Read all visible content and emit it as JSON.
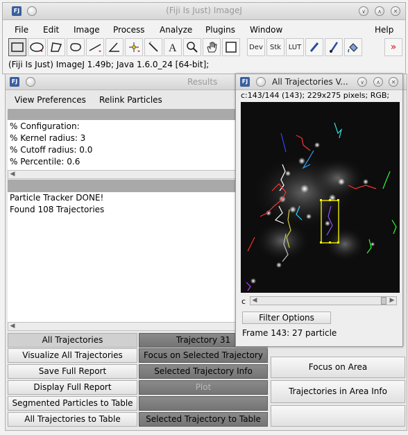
{
  "main_window": {
    "title": "(Fiji Is Just) ImageJ",
    "menu": [
      "File",
      "Edit",
      "Image",
      "Process",
      "Analyze",
      "Plugins",
      "Window",
      "Help"
    ],
    "tools": {
      "dev_label": "Dev",
      "stk_label": "Stk",
      "lut_label": "LUT",
      "more_label": "»"
    },
    "status": "(Fiji Is Just) ImageJ 1.49b; Java 1.6.0_24 [64-bit];"
  },
  "results_window": {
    "title": "Results",
    "menu": [
      "View Preferences",
      "Relink Particles"
    ],
    "config_lines": [
      "% Configuration:",
      "% Kernel radius: 3",
      "% Cutoff radius: 0.0",
      "% Percentile: 0.6"
    ],
    "log_lines": [
      "Particle Tracker DONE!",
      "Found 108 Trajectories"
    ],
    "buttons": {
      "all_trajectories_header": "All Trajectories",
      "trajectory_header": "Trajectory 31",
      "visualize_all": "Visualize All Trajectories",
      "focus_selected": "Focus on Selected Trajectory",
      "save_full_report": "Save Full Report",
      "selected_info": "Selected Trajectory Info",
      "display_full_report": "Display Full Report",
      "plot": "Plot",
      "segmented_to_table": "Segmented Particles to Table",
      "empty_right": "",
      "all_to_table": "All Trajectories to Table",
      "selected_to_table": "Selected Trajectory to Table",
      "focus_on_area": "Focus on Area",
      "area_info": "Trajectories in Area Info"
    }
  },
  "traj_window": {
    "title": "All Trajectories V...",
    "info": "c:143/144 (143); 229x275 pixels; RGB;",
    "slider_label": "c",
    "filter_button": "Filter Options",
    "frame_status": "Frame 143: 27 particle"
  },
  "colors": {
    "dark_button": "#808080",
    "title_text": "#9a9a9a",
    "image_bg": "#0d0d0d",
    "selection": "#ffff00"
  }
}
